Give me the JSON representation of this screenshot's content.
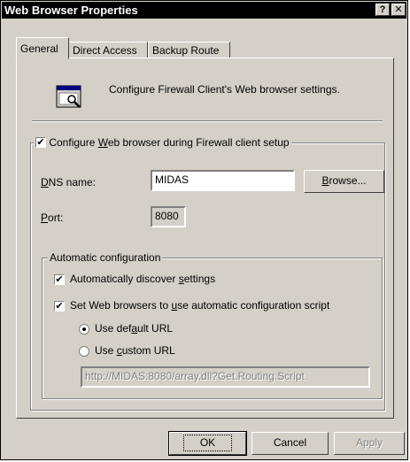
{
  "window": {
    "title": "Web Browser Properties",
    "help_glyph": "?",
    "close_glyph": "✕"
  },
  "tabs": [
    {
      "label": "General",
      "active": true
    },
    {
      "label": "Direct Access",
      "active": false
    },
    {
      "label": "Backup Route",
      "active": false
    }
  ],
  "header": {
    "icon": "browser-settings-icon",
    "text": "Configure Firewall Client's Web browser settings."
  },
  "configure_checkbox": {
    "label_pre": "Configure ",
    "label_ul": "W",
    "label_post": "eb browser during Firewall client setup",
    "checked": true
  },
  "dns": {
    "label_ul": "D",
    "label_post": "NS name:",
    "value": "MIDAS",
    "browse_ul": "B",
    "browse_post": "rowse..."
  },
  "port": {
    "label_ul": "P",
    "label_post": "ort:",
    "value": "8080"
  },
  "auto": {
    "group_title": "Automatic configuration",
    "discover": {
      "label_pre": "Automatically discover ",
      "label_ul": "s",
      "label_post": "ettings",
      "checked": true
    },
    "script": {
      "label_pre": "Set Web browsers to ",
      "label_ul": "u",
      "label_post": "se automatic configuration script",
      "checked": true
    },
    "default_url": {
      "label_pre": "Use def",
      "label_ul": "a",
      "label_post": "ult URL",
      "selected": true
    },
    "custom_url": {
      "label_pre": "Use ",
      "label_ul": "c",
      "label_post": "ustom URL",
      "selected": false
    },
    "url_value": "http://MIDAS:8080/array.dll?Get.Routing.Script"
  },
  "buttons": {
    "ok": "OK",
    "cancel": "Cancel",
    "apply": "Apply"
  },
  "check_glyph": "✔"
}
